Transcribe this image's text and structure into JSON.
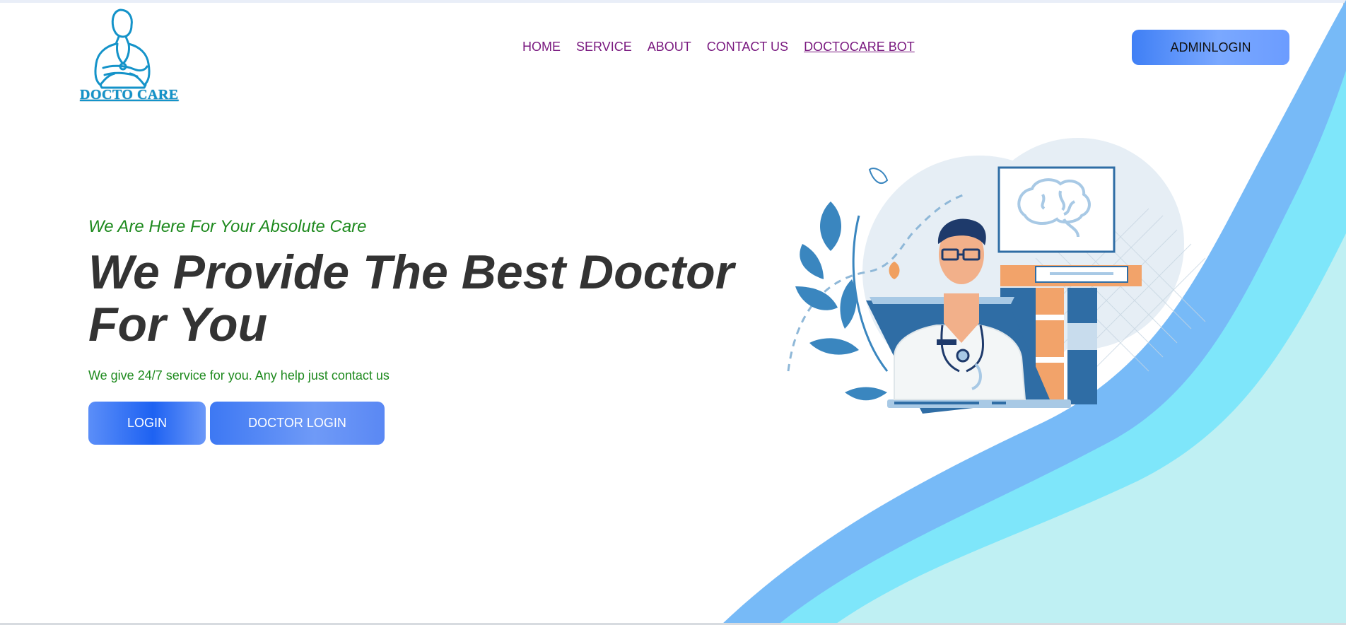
{
  "brand": {
    "logo_text": "DOCTO CARE"
  },
  "nav": {
    "items": [
      "HOME",
      "SERVICE",
      "ABOUT",
      "CONTACT US",
      "DOCTOCARE BOT"
    ]
  },
  "header": {
    "admin_button": "ADMINLOGIN"
  },
  "hero": {
    "tagline": "We Are Here For Your Absolute Care",
    "headline": "We Provide The Best Doctor For You",
    "subline": "We give 24/7 service for you. Any help just contact us",
    "login_button": "LOGIN",
    "doctor_login_button": "DOCTOR LOGIN"
  },
  "colors": {
    "nav_link": "#7a1a80",
    "accent_green": "#1e8a1e",
    "button_blue": "#1e62f2",
    "wave_light": "#bff0f3",
    "wave_cyan": "#7ee6fa",
    "wave_blue": "#77baf7",
    "heading": "#333333"
  },
  "icons": {
    "logo": "doctor-logo-icon",
    "illustration": "doctor-laptop-illustration"
  }
}
